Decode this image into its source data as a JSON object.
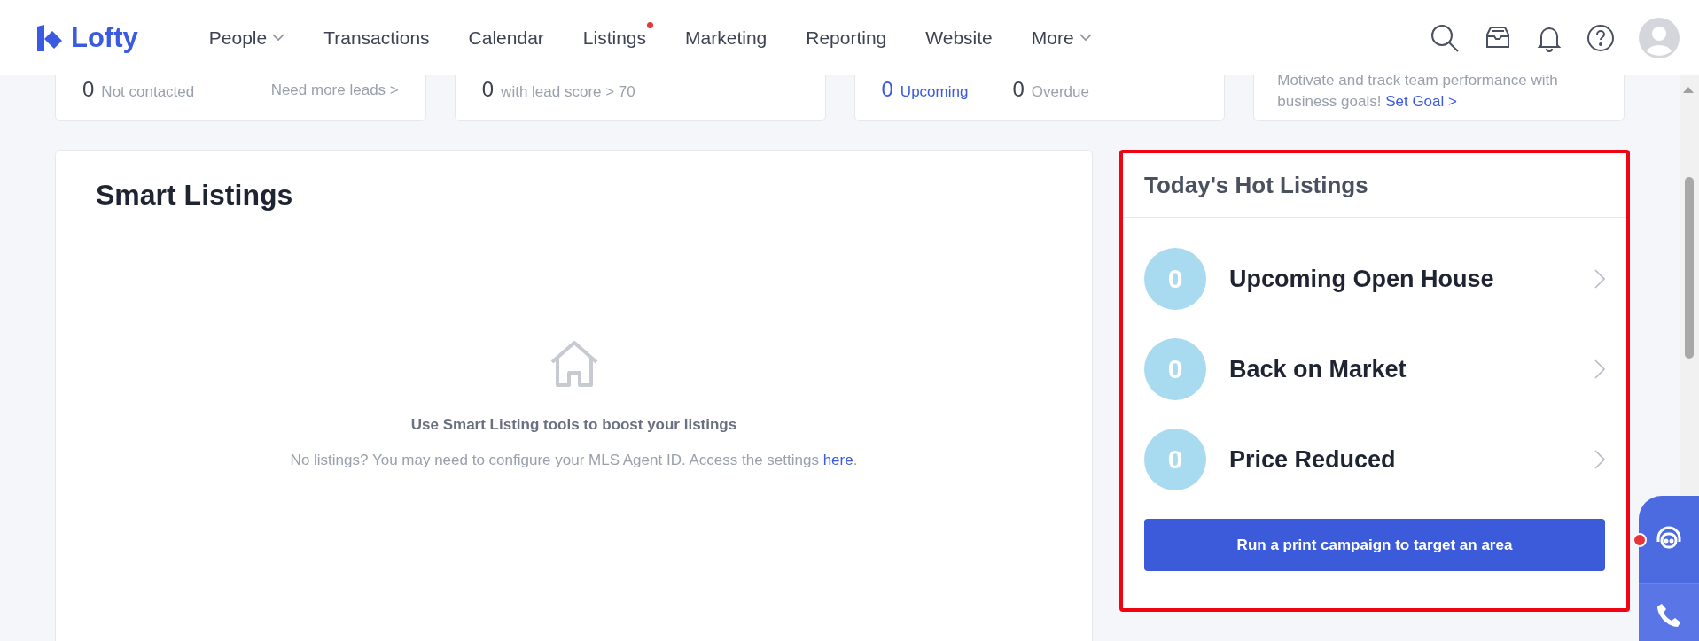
{
  "header": {
    "logo": "Lofty",
    "nav": [
      {
        "label": "People",
        "dropdown": true,
        "dot": false
      },
      {
        "label": "Transactions",
        "dropdown": false,
        "dot": false
      },
      {
        "label": "Calendar",
        "dropdown": false,
        "dot": false
      },
      {
        "label": "Listings",
        "dropdown": false,
        "dot": true
      },
      {
        "label": "Marketing",
        "dropdown": false,
        "dot": false
      },
      {
        "label": "Reporting",
        "dropdown": false,
        "dot": false
      },
      {
        "label": "Website",
        "dropdown": false,
        "dot": false
      },
      {
        "label": "More",
        "dropdown": true,
        "dot": false
      }
    ]
  },
  "summary_cards": [
    {
      "kind": "stats",
      "stats": [
        {
          "count": "0",
          "label": "Not contacted",
          "highlight": false
        }
      ],
      "link": "Need more leads >"
    },
    {
      "kind": "stats",
      "stats": [
        {
          "count": "0",
          "label": "with lead score > 70",
          "highlight": false
        }
      ]
    },
    {
      "kind": "stats",
      "stats": [
        {
          "count": "0",
          "label": "Upcoming",
          "highlight": true
        },
        {
          "count": "0",
          "label": "Overdue",
          "highlight": false
        }
      ]
    },
    {
      "kind": "text",
      "text": "Motivate and track team performance with business goals!",
      "link": "Set Goal >"
    }
  ],
  "smart_listings": {
    "title": "Smart Listings",
    "empty_title": "Use Smart Listing tools to boost your listings",
    "empty_text": "No listings? You may need to configure your MLS Agent ID. Access the settings ",
    "empty_link": "here",
    "empty_end": "."
  },
  "hot_listings": {
    "title": "Today's Hot Listings",
    "highlighted": true,
    "items": [
      {
        "count": "0",
        "label": "Upcoming Open House"
      },
      {
        "count": "0",
        "label": "Back on Market"
      },
      {
        "count": "0",
        "label": "Price Reduced"
      }
    ],
    "button": "Run a print campaign to target an area"
  },
  "side_widget": {
    "notification": true
  }
}
